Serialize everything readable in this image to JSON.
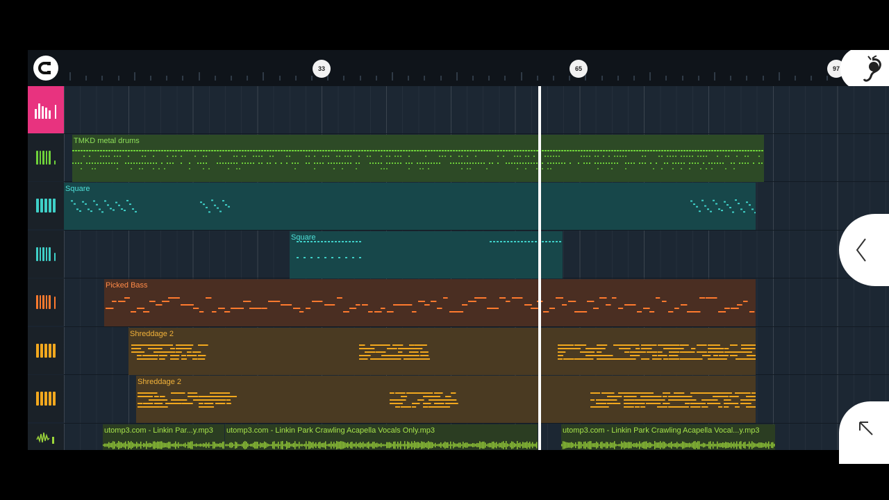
{
  "timeline": {
    "markers": [
      {
        "label": "33"
      },
      {
        "label": "65"
      },
      {
        "label": "97"
      }
    ]
  },
  "icons": {
    "snap": "magnet-icon",
    "fl": "fruit-logo-icon",
    "back": "chevron-left-icon",
    "expand": "arrow-up-left-icon"
  },
  "colors": {
    "active_header": "#e8337f",
    "drums": "#6fd23a",
    "square": "#3fd0c8",
    "bass": "#ff7a2e",
    "guitar": "#f2a81e",
    "audio": "#9cd63a"
  },
  "tracks": [
    {
      "name": "TMKD metal drums"
    },
    {
      "name": "Square"
    },
    {
      "name": "Square"
    },
    {
      "name": "Picked Bass"
    },
    {
      "name": "Shreddage 2"
    },
    {
      "name": "Shreddage 2"
    }
  ],
  "audio": {
    "clip1": "utomp3.com - Linkin Par...y.mp3",
    "clip2": "utomp3.com - Linkin Park  Crawling Acapella Vocals Only.mp3",
    "clip3": "utomp3.com - Linkin Park  Crawling Acapella Vocal...y.mp3"
  }
}
